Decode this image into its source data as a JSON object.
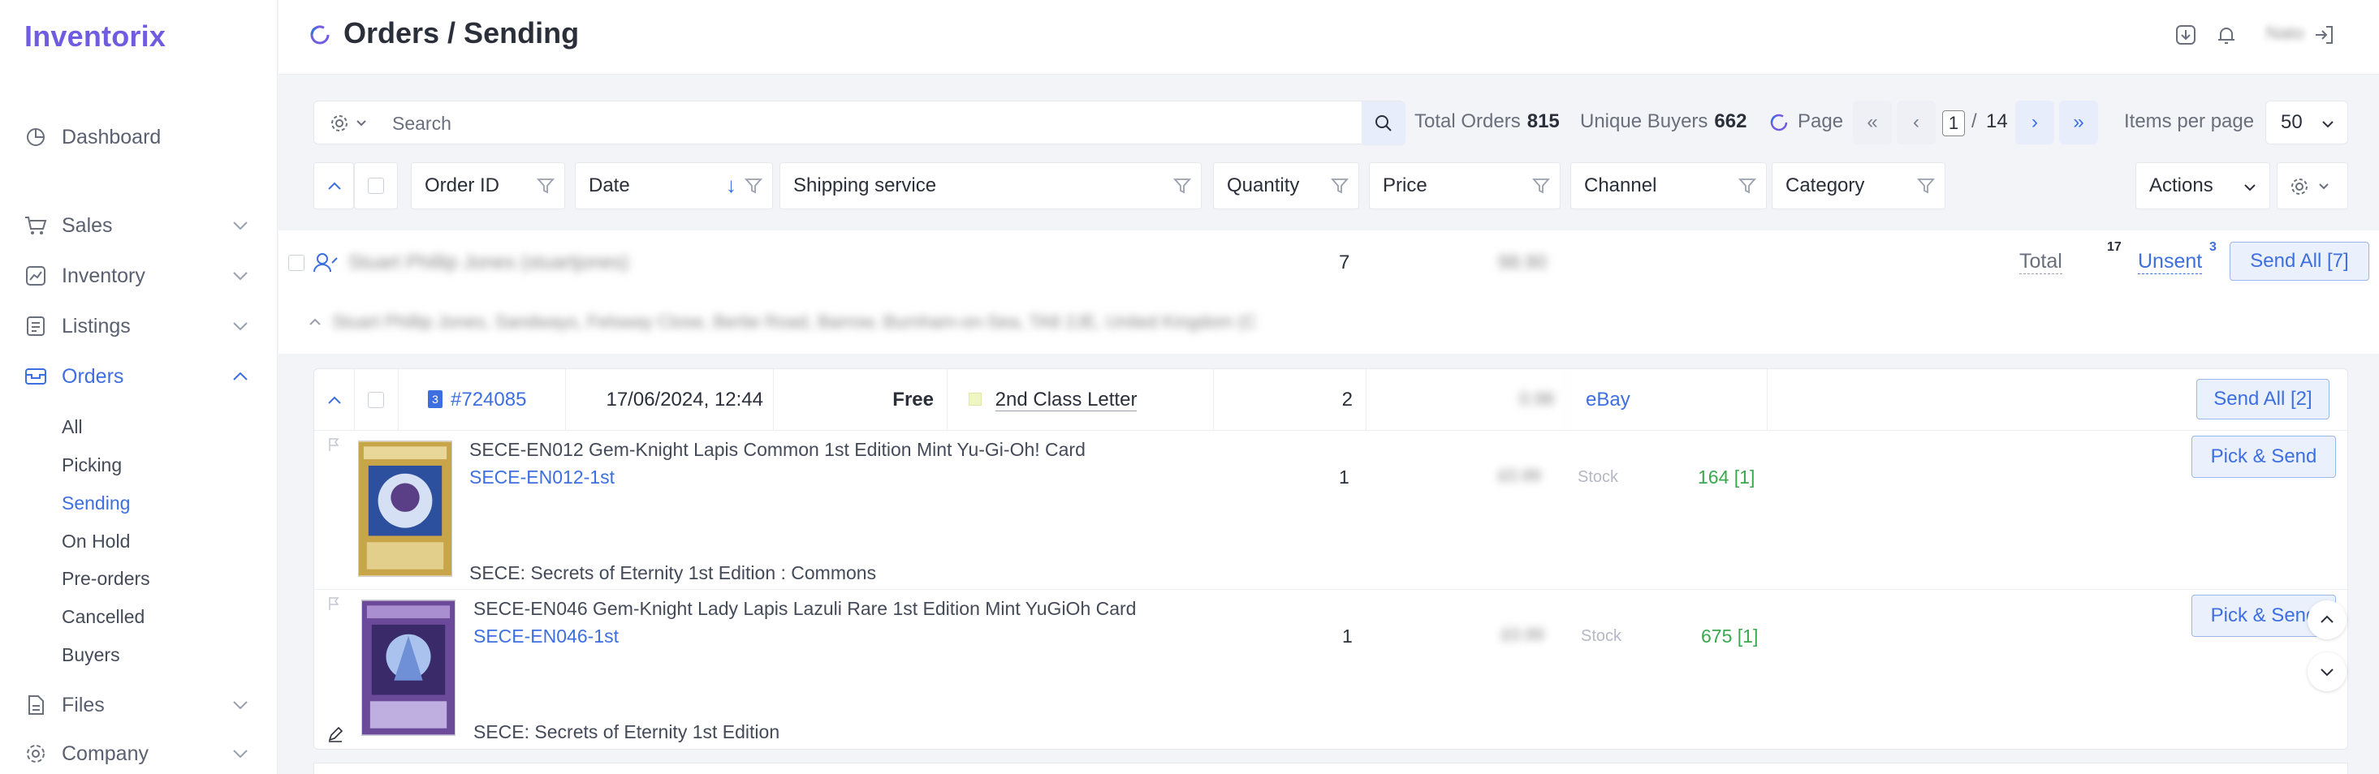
{
  "app": {
    "brand": "Inventorix"
  },
  "sidebar": {
    "items": [
      {
        "label": "Dashboard",
        "icon": "pie-chart-icon"
      },
      {
        "label": "Sales",
        "icon": "cart-icon"
      },
      {
        "label": "Inventory",
        "icon": "chart-icon"
      },
      {
        "label": "Listings",
        "icon": "list-icon"
      },
      {
        "label": "Orders",
        "icon": "orders-icon"
      },
      {
        "label": "Files",
        "icon": "file-icon"
      },
      {
        "label": "Company",
        "icon": "gear-icon"
      }
    ],
    "orders_sub": [
      "All",
      "Picking",
      "Sending",
      "On Hold",
      "Pre-orders",
      "Cancelled",
      "Buyers"
    ]
  },
  "header": {
    "title": "Orders / Sending",
    "user": "Nato"
  },
  "toolbar": {
    "search_placeholder": "Search",
    "total_orders_label": "Total Orders",
    "total_orders": "815",
    "unique_buyers_label": "Unique Buyers",
    "unique_buyers": "662",
    "page_label": "Page",
    "page_current": "1",
    "page_sep": "/",
    "page_total": "14",
    "items_per_page_label": "Items per page",
    "items_per_page": "50"
  },
  "columns": {
    "order_id": "Order ID",
    "date": "Date",
    "shipping": "Shipping service",
    "quantity": "Quantity",
    "price": "Price",
    "channel": "Channel",
    "category": "Category",
    "actions": "Actions"
  },
  "group": {
    "buyer": "Stuart Phillip Jones (stuartjones)",
    "address": "Stuart Phillip Jones, Sandways, Felsway Close, Bertie Road, Barrow, Burnham-on-Sea, TA8 2JE, United Kingdom (C",
    "quantity": "7",
    "price": "98.90",
    "total_label": "Total",
    "total_count": "17",
    "unsent_label": "Unsent",
    "unsent_count": "3",
    "send_all": "Send All [7]"
  },
  "order": {
    "id": "#724085",
    "badge": "3",
    "date": "17/06/2024, 12:44",
    "shipping_cost": "Free",
    "shipping_service": "2nd Class Letter",
    "quantity": "2",
    "price": "0.98",
    "channel": "eBay",
    "send_all": "Send All [2]",
    "items": [
      {
        "title": "SECE-EN012 Gem-Knight Lapis Common 1st Edition Mint Yu-Gi-Oh! Card",
        "sku": "SECE-EN012-1st",
        "category": "SECE: Secrets of Eternity 1st Edition : Commons",
        "quantity": "1",
        "price": "£0.99",
        "stock_label": "Stock",
        "stock": "164 [1]",
        "button": "Pick & Send"
      },
      {
        "title": "SECE-EN046 Gem-Knight Lady Lapis Lazuli Rare 1st Edition Mint YuGiOh Card",
        "sku": "SECE-EN046-1st",
        "category": "SECE: Secrets of Eternity 1st Edition",
        "quantity": "1",
        "price": "£0.99",
        "stock_label": "Stock",
        "stock": "675 [1]",
        "button": "Pick & Send"
      }
    ]
  },
  "colors": {
    "brand": "#6f5ce0",
    "accent": "#3d6fe0",
    "stock_ok": "#3aa84f"
  }
}
